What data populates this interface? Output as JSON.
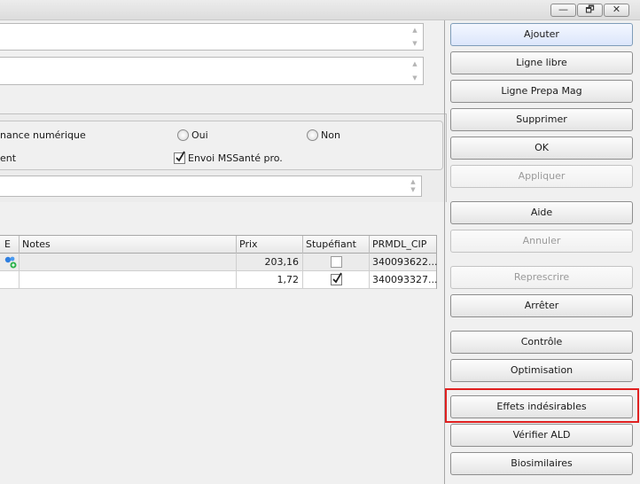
{
  "window": {
    "controls": {
      "minimize": "—",
      "restore": "🗗",
      "close": "✕"
    }
  },
  "form": {
    "dematerialisation_label": "nance numérique",
    "option_yes": "Oui",
    "option_no": "Non",
    "second_label": "ent",
    "mssante_label": "Envoi MSSanté pro.",
    "mssante_checked": true
  },
  "grid": {
    "columns": [
      "E",
      "Notes",
      "Prix",
      "Stupéfiant",
      "PRMDL_CIP"
    ],
    "rows": [
      {
        "e": "drug-molecule-icon",
        "notes": "",
        "prix": "203,16",
        "stupefiant": false,
        "cip": "340093622..."
      },
      {
        "e": "",
        "notes": "",
        "prix": "1,72",
        "stupefiant": true,
        "cip": "340093327..."
      }
    ]
  },
  "buttons": {
    "ajouter": "Ajouter",
    "ligne_libre": "Ligne libre",
    "ligne_prepa_mag": "Ligne Prepa Mag",
    "supprimer": "Supprimer",
    "ok": "OK",
    "appliquer": "Appliquer",
    "aide": "Aide",
    "annuler": "Annuler",
    "represcrire": "Represcrire",
    "arreter": "Arrêter",
    "controle": "Contrôle",
    "optimisation": "Optimisation",
    "effets_indesirables": "Effets indésirables",
    "verifier_ald": "Vérifier ALD",
    "biosimilaires": "Biosimilaires"
  },
  "colors": {
    "highlight": "#e02020",
    "active_button": "#dce6fb",
    "row_selected": "#ebebeb"
  }
}
